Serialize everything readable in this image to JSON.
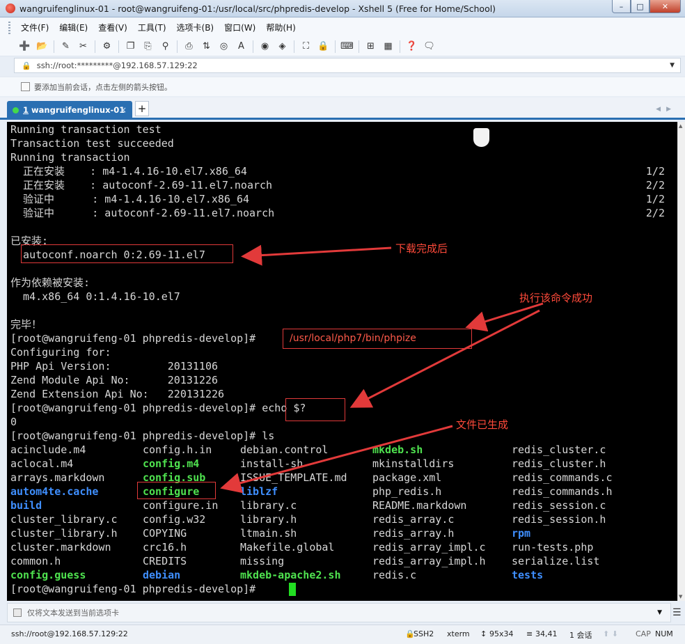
{
  "window": {
    "title": "wangruifenglinux-01 - root@wangruifeng-01:/usr/local/src/phpredis-develop - Xshell 5 (Free for Home/School)",
    "min_label": "–",
    "max_label": "□",
    "close_label": "✕"
  },
  "menu": [
    "文件(F)",
    "编辑(E)",
    "查看(V)",
    "工具(T)",
    "选项卡(B)",
    "窗口(W)",
    "帮助(H)"
  ],
  "address": {
    "value": "ssh://root:*********@192.168.57.129:22"
  },
  "hint": {
    "text": "要添加当前会话，点击左侧的箭头按钮。"
  },
  "tab": {
    "number": "1",
    "label": "wangruifenglinux-01",
    "close": "×",
    "add": "+"
  },
  "terminal": {
    "lines": [
      "Running transaction test",
      "Transaction test succeeded",
      "Running transaction",
      "  正在安装    : m4-1.4.16-10.el7.x86_64",
      "  正在安装    : autoconf-2.69-11.el7.noarch",
      "  验证中      : m4-1.4.16-10.el7.x86_64",
      "  验证中      : autoconf-2.69-11.el7.noarch",
      "",
      "已安装:",
      "  autoconf.noarch 0:2.69-11.el7",
      "",
      "作为依赖被安装:",
      "  m4.x86_64 0:1.4.16-10.el7",
      "",
      "完毕！",
      "[root@wangruifeng-01 phpredis-develop]#",
      "Configuring for:",
      "PHP Api Version:         20131106",
      "Zend Module Api No:      20131226",
      "Zend Extension Api No:   220131226",
      "[root@wangruifeng-01 phpredis-develop]# echo $?",
      "0",
      "[root@wangruifeng-01 phpredis-develop]# ls"
    ],
    "progress": [
      "1/2",
      "2/2",
      "1/2",
      "2/2"
    ],
    "ls_columns": [
      [
        {
          "name": "acinclude.m4",
          "type": "file"
        },
        {
          "name": "aclocal.m4",
          "type": "file"
        },
        {
          "name": "arrays.markdown",
          "type": "file"
        },
        {
          "name": "autom4te.cache",
          "type": "dir"
        },
        {
          "name": "build",
          "type": "dir"
        },
        {
          "name": "cluster_library.c",
          "type": "file"
        },
        {
          "name": "cluster_library.h",
          "type": "file"
        },
        {
          "name": "cluster.markdown",
          "type": "file"
        },
        {
          "name": "common.h",
          "type": "file"
        },
        {
          "name": "config.guess",
          "type": "exec"
        }
      ],
      [
        {
          "name": "config.h.in",
          "type": "file"
        },
        {
          "name": "config.m4",
          "type": "exec"
        },
        {
          "name": "config.sub",
          "type": "exec"
        },
        {
          "name": "configure",
          "type": "exec"
        },
        {
          "name": "configure.in",
          "type": "file"
        },
        {
          "name": "config.w32",
          "type": "file"
        },
        {
          "name": "COPYING",
          "type": "file"
        },
        {
          "name": "crc16.h",
          "type": "file"
        },
        {
          "name": "CREDITS",
          "type": "file"
        },
        {
          "name": "debian",
          "type": "dir"
        }
      ],
      [
        {
          "name": "debian.control",
          "type": "file"
        },
        {
          "name": "install-sh",
          "type": "file"
        },
        {
          "name": "ISSUE_TEMPLATE.md",
          "type": "file"
        },
        {
          "name": "liblzf",
          "type": "dir"
        },
        {
          "name": "library.c",
          "type": "file"
        },
        {
          "name": "library.h",
          "type": "file"
        },
        {
          "name": "ltmain.sh",
          "type": "file"
        },
        {
          "name": "Makefile.global",
          "type": "file"
        },
        {
          "name": "missing",
          "type": "file"
        },
        {
          "name": "mkdeb-apache2.sh",
          "type": "exec"
        }
      ],
      [
        {
          "name": "mkdeb.sh",
          "type": "exec"
        },
        {
          "name": "mkinstalldirs",
          "type": "file"
        },
        {
          "name": "package.xml",
          "type": "file"
        },
        {
          "name": "php_redis.h",
          "type": "file"
        },
        {
          "name": "README.markdown",
          "type": "file"
        },
        {
          "name": "redis_array.c",
          "type": "file"
        },
        {
          "name": "redis_array.h",
          "type": "file"
        },
        {
          "name": "redis_array_impl.c",
          "type": "file"
        },
        {
          "name": "redis_array_impl.h",
          "type": "file"
        },
        {
          "name": "redis.c",
          "type": "file"
        }
      ],
      [
        {
          "name": "redis_cluster.c",
          "type": "file"
        },
        {
          "name": "redis_cluster.h",
          "type": "file"
        },
        {
          "name": "redis_commands.c",
          "type": "file"
        },
        {
          "name": "redis_commands.h",
          "type": "file"
        },
        {
          "name": "redis_session.c",
          "type": "file"
        },
        {
          "name": "redis_session.h",
          "type": "file"
        },
        {
          "name": "rpm",
          "type": "dir"
        },
        {
          "name": "run-tests.php",
          "type": "file"
        },
        {
          "name": "serialize.list",
          "type": "file"
        },
        {
          "name": "tests",
          "type": "dir"
        }
      ]
    ],
    "final_prompt": "[root@wangruifeng-01 phpredis-develop]#"
  },
  "annotations": {
    "download_done": "下载完成后",
    "command_success": "执行该命令成功",
    "file_generated": "文件已生成",
    "phpize_cmd": "/usr/local/php7/bin/phpize",
    "color": "#e23a3a"
  },
  "send_bar": {
    "text": "仅将文本发送到当前选项卡"
  },
  "status": {
    "connection": "ssh://root@192.168.57.129:22",
    "protocol": "SSH2",
    "term": "xterm",
    "size": "95x34",
    "position": "34,41",
    "sessions": "1 会话",
    "cap": "CAP",
    "num": "NUM"
  },
  "colors": {
    "terminal_bg": "#000000",
    "terminal_fg": "#d7d7d7",
    "exec_green": "#4fe24f",
    "dir_blue": "#3f8fff",
    "tab_blue": "#2a6fb2"
  }
}
